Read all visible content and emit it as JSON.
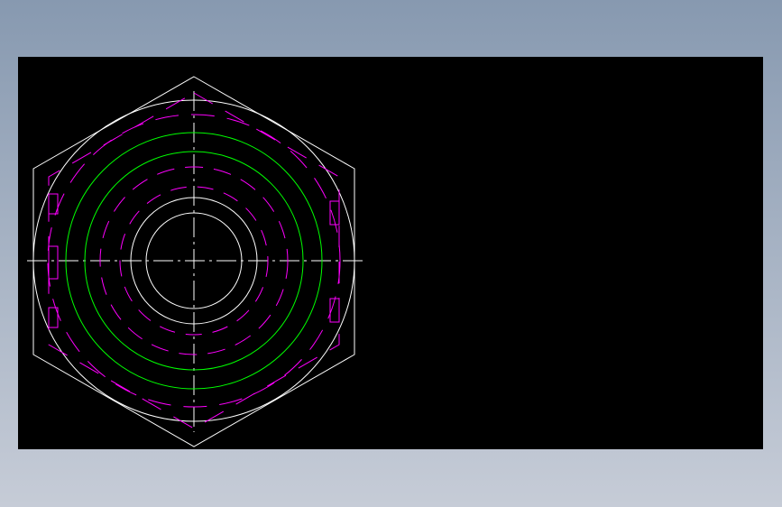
{
  "drawing": {
    "subject": "hexagon-nut-top-view",
    "colors": {
      "background_window": "#8e9cb2",
      "viewport": "#000000",
      "outline": "#ffffff",
      "thread": "#00ff00",
      "hidden": "#ff00ff",
      "centerline": "#ffffff"
    }
  }
}
